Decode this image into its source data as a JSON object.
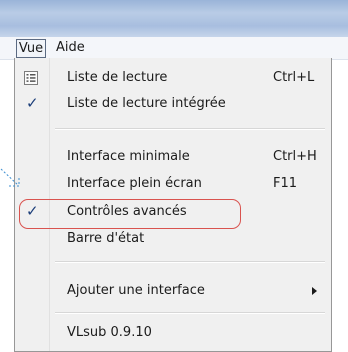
{
  "menubar": {
    "items": [
      {
        "label": "Vue"
      },
      {
        "label": "Aide"
      }
    ]
  },
  "menu": {
    "items": [
      {
        "label": "Liste de lecture",
        "shortcut": "Ctrl+L",
        "icon": "playlist-icon"
      },
      {
        "label": "Liste de lecture intégrée",
        "checked": true
      },
      {
        "label": "Interface minimale",
        "shortcut": "Ctrl+H"
      },
      {
        "label": "Interface plein écran",
        "shortcut": "F11"
      },
      {
        "label": "Contrôles avancés",
        "checked": true,
        "highlighted": true
      },
      {
        "label": "Barre d'état"
      },
      {
        "label": "Ajouter une interface",
        "submenu": true
      },
      {
        "label": "VLsub 0.9.10"
      }
    ]
  },
  "colors": {
    "highlight_outline": "#d9534f",
    "checkmark": "#1d3f7a",
    "pointer": "#3d8fd1"
  }
}
